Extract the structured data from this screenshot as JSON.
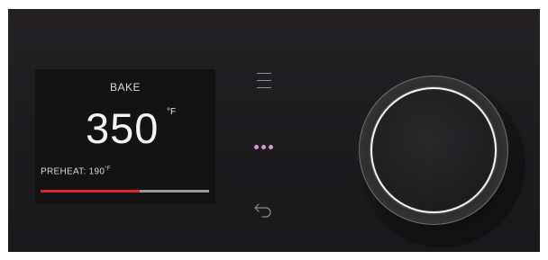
{
  "display": {
    "mode": "BAKE",
    "temperature": "350",
    "temperature_unit": "°F",
    "preheat_label": "PREHEAT: 190",
    "preheat_unit": "°F",
    "preheat_progress_fraction": 0.59
  },
  "controls": {
    "menu_icon": "menu-icon",
    "more_icon": "more-options-icon",
    "back_icon": "back-arrow-icon",
    "knob": "control-knob"
  },
  "colors": {
    "accent_more": "#d49bd0",
    "progress_fill": "#e0242a",
    "progress_track": "#9b9a9c"
  }
}
